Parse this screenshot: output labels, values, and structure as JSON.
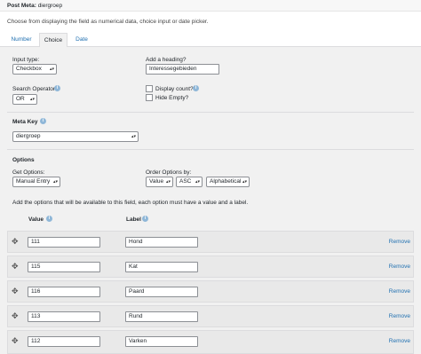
{
  "header": {
    "title_label": "Post Meta:",
    "title_value": "diergroep"
  },
  "description": "Choose from displaying the field as numerical data, choice input or date picker.",
  "tabs": [
    {
      "label": "Number"
    },
    {
      "label": "Choice",
      "active": true
    },
    {
      "label": "Date"
    }
  ],
  "input_type": {
    "label": "Input type:",
    "value": "Checkbox"
  },
  "heading": {
    "label": "Add a heading?",
    "value": "Interessegebieden"
  },
  "search_operator": {
    "label": "Search Operator",
    "value": "OR"
  },
  "display_count": {
    "label": "Display count?"
  },
  "hide_empty": {
    "label": "Hide Empty?"
  },
  "meta_key": {
    "label": "Meta Key",
    "value": "diergroep"
  },
  "options": {
    "title": "Options",
    "get_options_label": "Get Options:",
    "get_options_value": "Manual Entry",
    "order_label": "Order Options by:",
    "order_by": "Value",
    "order_dir": "ASC",
    "order_type": "Alphabetical",
    "help": "Add the options that will be available to this field, each option must have a value and a label.",
    "value_header": "Value",
    "label_header": "Label",
    "remove_label": "Remove",
    "items": [
      {
        "value": "111",
        "label": "Hond"
      },
      {
        "value": "115",
        "label": "Kat"
      },
      {
        "value": "116",
        "label": "Paard"
      },
      {
        "value": "113",
        "label": "Rund"
      },
      {
        "value": "112",
        "label": "Varken"
      }
    ]
  },
  "colors": {
    "link": "#2271b1",
    "panel": "#f1f1f1",
    "info_icon": "#8fb7d8"
  }
}
